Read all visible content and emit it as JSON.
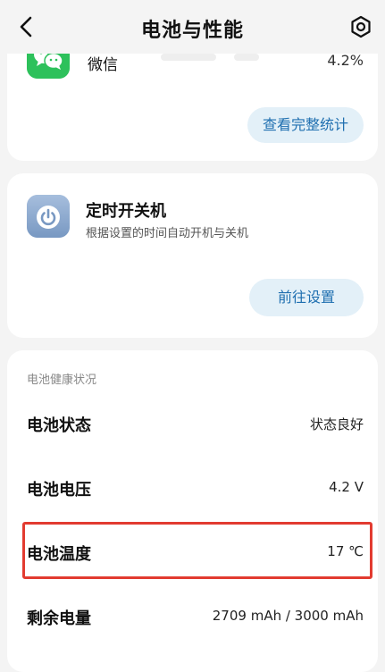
{
  "header": {
    "title": "电池与性能",
    "back_icon": "back-arrow-icon",
    "settings_icon": "gear-icon"
  },
  "app_usage": {
    "app_name": "微信",
    "percent": "4.2%",
    "app_icon": "wechat-icon",
    "button_label": "查看完整统计"
  },
  "scheduled_power": {
    "title": "定时开关机",
    "description": "根据设置的时间自动开机与关机",
    "icon": "power-icon",
    "button_label": "前往设置"
  },
  "battery_health": {
    "section_title": "电池健康状况",
    "rows": [
      {
        "label": "电池状态",
        "value": "状态良好"
      },
      {
        "label": "电池电压",
        "value": "4.2 V"
      },
      {
        "label": "电池温度",
        "value": "17 ℃"
      },
      {
        "label": "剩余电量",
        "value": "2709 mAh / 3000 mAh"
      }
    ]
  },
  "colors": {
    "accent_button_bg": "#e3f0f8",
    "accent_button_text": "#1f6fb0",
    "highlight_border": "#e23b30",
    "wechat_green": "#2dc15b"
  }
}
